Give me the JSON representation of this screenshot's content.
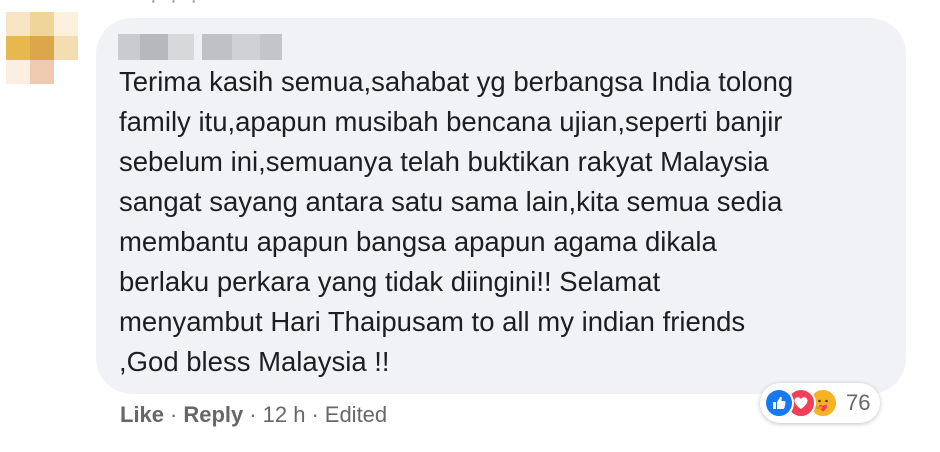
{
  "comment": {
    "text": "Terima kasih semua,sahabat yg berbangsa India tolong\nfamily itu,apapun musibah bencana ujian,seperti banjir\nsebelum ini,semuanya telah buktikan rakyat Malaysia\nsangat sayang antara satu sama lain,kita semua sedia\nmembantu apapun bangsa apapun agama dikala\nberlaku perkara yang tidak diingini!! Selamat\nmenyambut Hari Thaipusam to all my indian friends\n,God bless Malaysia !!"
  },
  "actions": {
    "like_label": "Like",
    "reply_label": "Reply",
    "separator": "·",
    "time": "12 h",
    "edited_label": "Edited"
  },
  "reactions": {
    "icons": [
      "like-icon",
      "love-icon",
      "care-icon"
    ],
    "count": "76",
    "colors": {
      "like": "#1877f2",
      "love": "#f33e58",
      "care": "#f7b125"
    }
  },
  "colors": {
    "bubble": "#f0f2f5",
    "text": "#1c1e21",
    "meta": "#65676b"
  }
}
